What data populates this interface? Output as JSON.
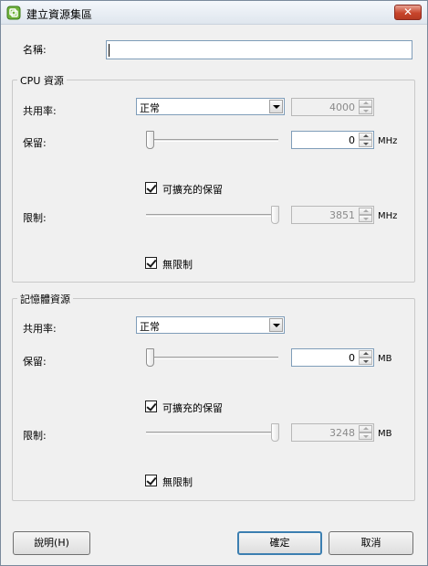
{
  "window": {
    "title": "建立資源集區"
  },
  "name_field": {
    "label": "名稱:",
    "value": ""
  },
  "cpu": {
    "group_label": "CPU 資源",
    "shares": {
      "label": "共用率:",
      "selected": "正常",
      "value": "4000"
    },
    "reservation": {
      "label": "保留:",
      "value": "0",
      "unit": "MHz",
      "slider_fraction": 0
    },
    "expandable": {
      "label": "可擴充的保留",
      "checked": true
    },
    "limit": {
      "label": "限制:",
      "value": "3851",
      "unit": "MHz",
      "slider_fraction": 1
    },
    "unlimited": {
      "label": "無限制",
      "checked": true
    }
  },
  "memory": {
    "group_label": "記憶體資源",
    "shares": {
      "label": "共用率:",
      "selected": "正常"
    },
    "reservation": {
      "label": "保留:",
      "value": "0",
      "unit": "MB",
      "slider_fraction": 0
    },
    "expandable": {
      "label": "可擴充的保留",
      "checked": true
    },
    "limit": {
      "label": "限制:",
      "value": "3248",
      "unit": "MB",
      "slider_fraction": 1
    },
    "unlimited": {
      "label": "無限制",
      "checked": true
    }
  },
  "buttons": {
    "help": "說明(H)",
    "ok": "確定",
    "cancel": "取消"
  },
  "colors": {
    "close_button": "#c8452c",
    "focus_border": "#3c7fb1"
  }
}
